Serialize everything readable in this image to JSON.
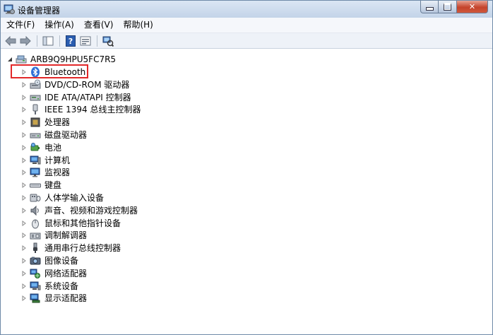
{
  "window": {
    "title": "设备管理器"
  },
  "menu": [
    "文件(F)",
    "操作(A)",
    "查看(V)",
    "帮助(H)"
  ],
  "tree": {
    "root": "ARB9Q9HPU5FC7R5",
    "items": [
      {
        "label": "Bluetooth",
        "icon": "bluetooth-icon"
      },
      {
        "label": "DVD/CD-ROM 驱动器",
        "icon": "dvd-drive-icon"
      },
      {
        "label": "IDE ATA/ATAPI 控制器",
        "icon": "ide-controller-icon"
      },
      {
        "label": "IEEE 1394 总线主控制器",
        "icon": "ieee1394-icon"
      },
      {
        "label": "处理器",
        "icon": "processor-icon"
      },
      {
        "label": "磁盘驱动器",
        "icon": "disk-drive-icon"
      },
      {
        "label": "电池",
        "icon": "battery-icon"
      },
      {
        "label": "计算机",
        "icon": "computer-icon"
      },
      {
        "label": "监视器",
        "icon": "monitor-icon"
      },
      {
        "label": "键盘",
        "icon": "keyboard-icon"
      },
      {
        "label": "人体学输入设备",
        "icon": "hid-icon"
      },
      {
        "label": "声音、视频和游戏控制器",
        "icon": "sound-icon"
      },
      {
        "label": "鼠标和其他指针设备",
        "icon": "mouse-icon"
      },
      {
        "label": "调制解调器",
        "icon": "modem-icon"
      },
      {
        "label": "通用串行总线控制器",
        "icon": "usb-icon"
      },
      {
        "label": "图像设备",
        "icon": "imaging-icon"
      },
      {
        "label": "网络适配器",
        "icon": "network-adapter-icon"
      },
      {
        "label": "系统设备",
        "icon": "system-device-icon"
      },
      {
        "label": "显示适配器",
        "icon": "display-adapter-icon"
      }
    ]
  },
  "colors": {
    "highlight": "#e2292a",
    "close": "#c4432b",
    "titlebar": "#c3d3e8"
  }
}
